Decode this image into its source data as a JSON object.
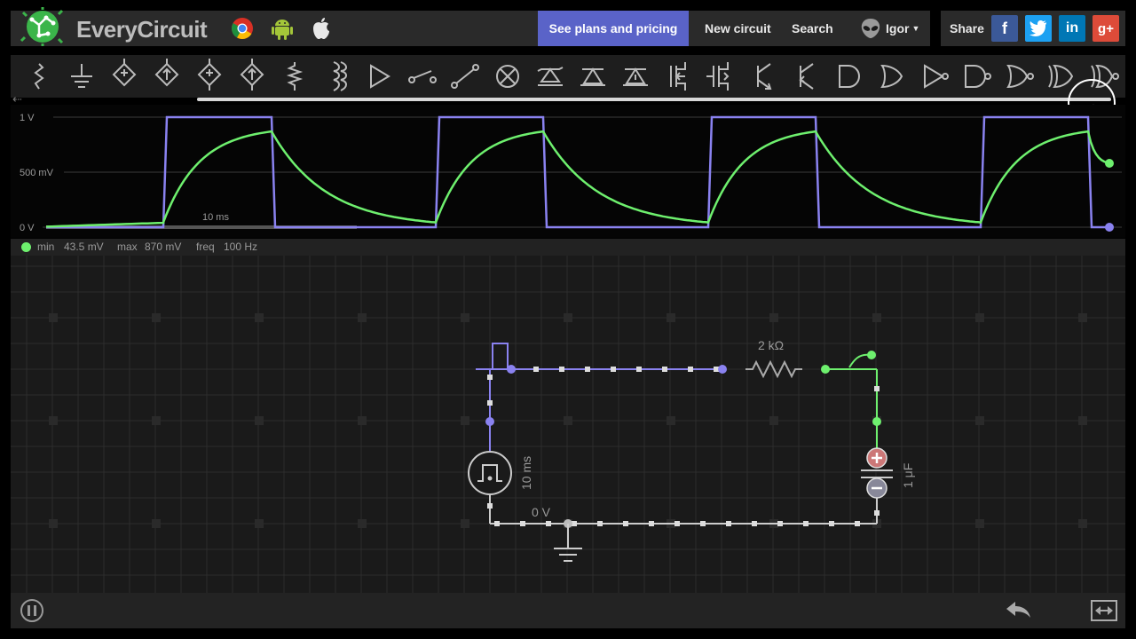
{
  "header": {
    "app_name": "EveryCircuit",
    "plans_label": "See plans and pricing",
    "new_circuit_label": "New circuit",
    "search_label": "Search",
    "user_label": "Igor",
    "share_label": "Share",
    "platform_icons": [
      "chrome-icon",
      "android-icon",
      "apple-icon"
    ],
    "share_icons": [
      "facebook-icon",
      "twitter-icon",
      "linkedin-icon",
      "google-plus-icon"
    ],
    "accent_color": "#5a63c8"
  },
  "toolbar": {
    "components": [
      "wire-icon",
      "ground-icon",
      "voltage-source-icon",
      "current-source-icon",
      "dependent-voltage-source-icon",
      "dependent-current-source-icon",
      "resistor-icon",
      "inductor-icon",
      "diode-icon",
      "switch-open-icon",
      "switch-icon",
      "lamp-icon",
      "zener-diode-icon",
      "led-icon",
      "led-alt-icon",
      "nmos-icon",
      "pmos-icon",
      "npn-icon",
      "pnp-icon",
      "and-gate-icon",
      "or-gate-icon",
      "buffer-icon",
      "nand-gate-icon",
      "nor-gate-icon",
      "xor-gate-icon",
      "xnor-gate-icon"
    ]
  },
  "scope": {
    "y_labels": [
      "1 V",
      "500 mV",
      "0 V"
    ],
    "time_label": "10 ms",
    "colors": {
      "input": "#8a82f0",
      "output": "#6ef06e"
    }
  },
  "scope_info": {
    "min_label": "min",
    "min_value": "43.5 mV",
    "max_label": "max",
    "max_value": "870 mV",
    "freq_label": "freq",
    "freq_value": "100 Hz"
  },
  "circuit": {
    "resistor_label": "2 kΩ",
    "source_label": "10 ms",
    "ground_label": "0 V",
    "capacitor_label": "1 μF"
  },
  "bottombar": {
    "icons": [
      "pause-icon",
      "undo-icon",
      "fit-screen-icon"
    ]
  }
}
